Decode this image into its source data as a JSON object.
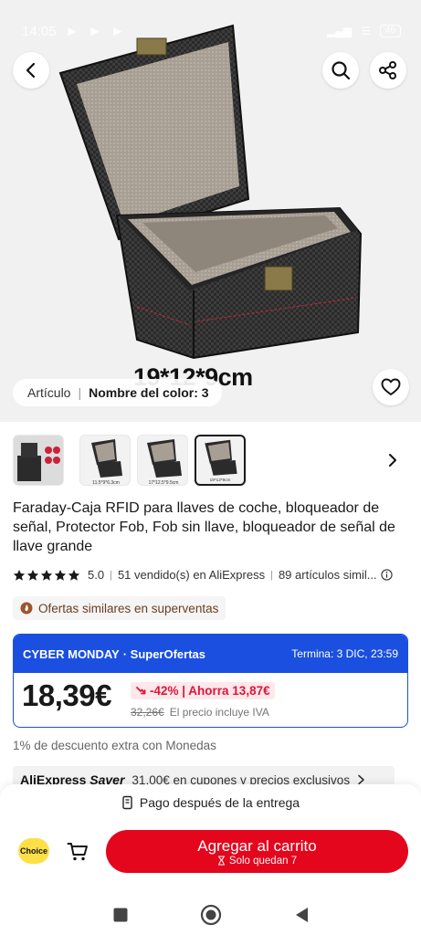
{
  "status_bar": {
    "time": "14:05",
    "battery": "46"
  },
  "hero": {
    "dimensions_caption": "19*12*9cm",
    "variant_label": "Artículo",
    "variant_value": "Nombre del color: 3"
  },
  "thumbnails": {
    "items": [
      {
        "caption": ""
      },
      {
        "caption": "11.5*9*6.3cm"
      },
      {
        "caption": "17*12.5*9.5cm"
      },
      {
        "caption": "19*12*9cm"
      }
    ],
    "active_index": 3
  },
  "product": {
    "title": "Faraday-Caja RFID para llaves de coche, bloqueador de señal, Protector Fob, Fob sin llave, bloqueador de señal de llave grande",
    "rating": "5.0",
    "sold": "51 vendido(s) en AliExpress",
    "reviews": "89 artículos simil...",
    "similar_badge": "Ofertas similares en superventas"
  },
  "deal": {
    "event": "CYBER MONDAY",
    "event_suffix": "· SuperOfertas",
    "ends": "Termina: 3 DIC, 23:59",
    "price": "18,39€",
    "discount": "-42% | Ahorra 13,87€",
    "old_price": "32,26€",
    "tax_note": "El precio incluye IVA",
    "colors": {
      "blue": "#1a4fe0",
      "red": "#e0153b"
    }
  },
  "coins_text": "1% de descuento extra con Monedas",
  "saver": {
    "brand": "AliExpress",
    "brand_suffix": "Saver",
    "text": "31,00€ en cupones y precios exclusivos"
  },
  "bottom_bar": {
    "pay_after": "Pago después de la entrega",
    "choice": "Choice",
    "add_to_cart": "Agregar al carrito",
    "stock_note": "Solo quedan 7",
    "accent": "#e3061d"
  }
}
